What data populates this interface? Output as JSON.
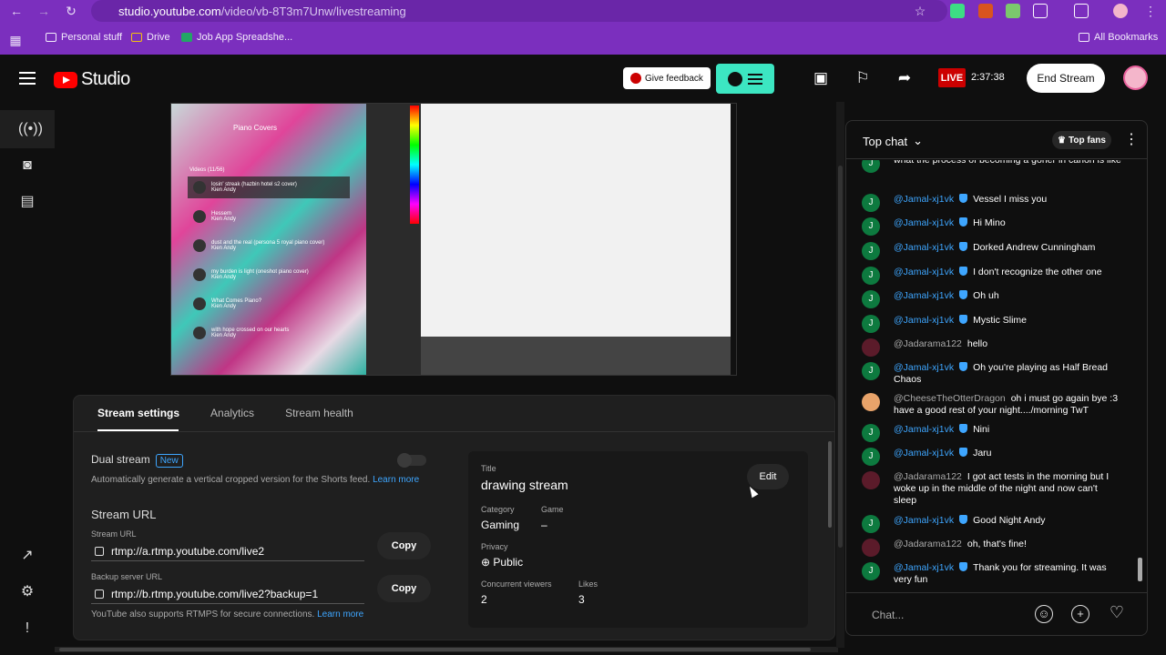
{
  "browser": {
    "url_host": "studio.youtube.com",
    "url_path": "/video/vb-8T3m7Unw/livestreaming",
    "bookmarks": [
      {
        "label": "Personal stuff"
      },
      {
        "label": "Drive"
      },
      {
        "label": "Job App Spreadshe..."
      }
    ],
    "all_bookmarks": "All Bookmarks"
  },
  "header": {
    "app_name": "Studio",
    "give_feedback": "Give feedback",
    "live_badge": "LIVE",
    "live_timer": "2:37:38",
    "end_stream": "End Stream"
  },
  "preview": {
    "playlist_title": "Piano Covers",
    "videos_label": "Videos (11/56)",
    "items": [
      {
        "title": "losin' streak (hazbin hotel s2 cover)",
        "sub": "Kien Andy"
      },
      {
        "title": "Hessem",
        "sub": "Kien Andy"
      },
      {
        "title": "dust and the real (persona 5 royal piano cover)",
        "sub": "Kien Andy"
      },
      {
        "title": "my burden is light (oneshot piano cover)",
        "sub": "Kien Andy"
      },
      {
        "title": "What Comes Piano?",
        "sub": "Kien Andy"
      },
      {
        "title": "with hope crossed on our hearts",
        "sub": "Kien Andy"
      }
    ]
  },
  "tabs": {
    "stream_settings": "Stream settings",
    "analytics": "Analytics",
    "stream_health": "Stream health"
  },
  "settings": {
    "dual_stream": "Dual stream",
    "new_badge": "New",
    "dual_desc": "Automatically generate a vertical cropped version for the Shorts feed.",
    "learn_more": "Learn more",
    "stream_url_heading": "Stream URL",
    "stream_url_label": "Stream URL",
    "stream_url": "rtmp://a.rtmp.youtube.com/live2",
    "backup_label": "Backup server URL",
    "backup_url": "rtmp://b.rtmp.youtube.com/live2?backup=1",
    "copy": "Copy",
    "rtmps_note": "YouTube also supports RTMPS for secure connections.",
    "learn_more_2": "Learn more"
  },
  "info": {
    "title_label": "Title",
    "title": "drawing stream",
    "edit": "Edit",
    "category_label": "Category",
    "category": "Gaming",
    "game_label": "Game",
    "game": "–",
    "privacy_label": "Privacy",
    "privacy": "Public",
    "viewers_label": "Concurrent viewers",
    "viewers": "2",
    "likes_label": "Likes",
    "likes": "3"
  },
  "chat": {
    "title": "Top chat",
    "top_fans": "Top fans",
    "placeholder": "Chat...",
    "messages": [
      {
        "initial": "J",
        "author": "",
        "text": "what the process of becoming a goner in canon is like"
      },
      {
        "initial": "J",
        "author": "@Jamal-xj1vk",
        "text": "Vessel I miss you"
      },
      {
        "initial": "J",
        "author": "@Jamal-xj1vk",
        "text": "Hi Mino"
      },
      {
        "initial": "J",
        "author": "@Jamal-xj1vk",
        "text": "Dorked Andrew Cunningham"
      },
      {
        "initial": "J",
        "author": "@Jamal-xj1vk",
        "text": "I don't recognize the other one"
      },
      {
        "initial": "J",
        "author": "@Jamal-xj1vk",
        "text": "Oh uh"
      },
      {
        "initial": "J",
        "author": "@Jamal-xj1vk",
        "text": "Mystic Slime"
      },
      {
        "initial": "",
        "author": "@Jadarama122",
        "text": "hello"
      },
      {
        "initial": "J",
        "author": "@Jamal-xj1vk",
        "text": "Oh you're playing as Half Bread Chaos"
      },
      {
        "initial": "",
        "author": "@CheeseTheOtterDragon",
        "text": "oh i must go again bye :3 have a good rest of your night..../morning TwT"
      },
      {
        "initial": "J",
        "author": "@Jamal-xj1vk",
        "text": "Nini"
      },
      {
        "initial": "J",
        "author": "@Jamal-xj1vk",
        "text": "Jaru"
      },
      {
        "initial": "",
        "author": "@Jadarama122",
        "text": "I got act tests in the morning but I woke up in the middle of the night and now can't sleep"
      },
      {
        "initial": "J",
        "author": "@Jamal-xj1vk",
        "text": "Good Night Andy"
      },
      {
        "initial": "",
        "author": "@Jadarama122",
        "text": "oh, that's fine!"
      },
      {
        "initial": "J",
        "author": "@Jamal-xj1vk",
        "text": "Thank you for streaming. It was very fun"
      }
    ]
  }
}
